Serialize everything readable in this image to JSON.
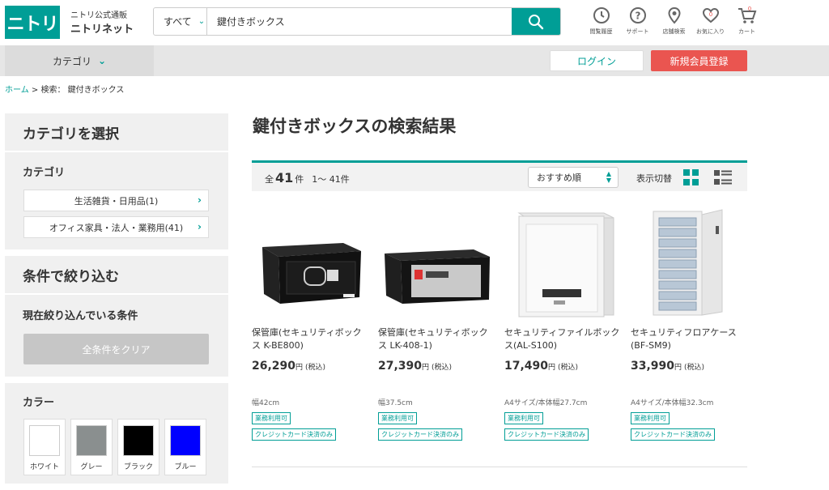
{
  "header": {
    "logo_text": "ニトリ",
    "logo_sub": "ニトリ公式通販",
    "logo_main": "ニトリネット",
    "search_scope": "すべて",
    "search_value": "鍵付きボックス",
    "icons": [
      {
        "name": "history-icon",
        "label": "閲覧履歴"
      },
      {
        "name": "support-icon",
        "label": "サポート"
      },
      {
        "name": "store-search-icon",
        "label": "店舗検索"
      },
      {
        "name": "favorite-icon",
        "label": "お気に入り",
        "badge": "0"
      },
      {
        "name": "cart-icon",
        "label": "カート",
        "badge": "0"
      }
    ]
  },
  "nav": {
    "category": "カテゴリ",
    "login": "ログイン",
    "register": "新規会員登録"
  },
  "breadcrumb": {
    "home": "ホーム",
    "sep": ">",
    "current": "検索： 鍵付きボックス"
  },
  "sidebar": {
    "category_select_title": "カテゴリを選択",
    "category_label": "カテゴリ",
    "categories": [
      {
        "label": "生活雑貨・日用品(1)"
      },
      {
        "label": "オフィス家具・法人・業務用(41)"
      }
    ],
    "filter_title": "条件で絞り込む",
    "current_filter_label": "現在絞り込んでいる条件",
    "clear_all": "全条件をクリア",
    "color_label": "カラー",
    "colors": [
      {
        "label": "ホワイト",
        "hex": "#ffffff"
      },
      {
        "label": "グレー",
        "hex": "#8a8f8f"
      },
      {
        "label": "ブラック",
        "hex": "#000000"
      },
      {
        "label": "ブルー",
        "hex": "#0000ff"
      }
    ]
  },
  "results": {
    "title": "鍵付きボックスの検索結果",
    "total_prefix": "全",
    "total": "41",
    "total_suffix": "件",
    "range": "1～ 41件",
    "sort": "おすすめ順",
    "view_label": "表示切替"
  },
  "products": [
    {
      "name": "保管庫(セキュリティボックス K-BE800)",
      "price": "26,290",
      "yen": "円",
      "tax": "(税込)",
      "size": "幅42cm",
      "tags": [
        "業務利用可",
        "クレジットカード決済のみ"
      ]
    },
    {
      "name": "保管庫(セキュリティボックス LK-408-1)",
      "price": "27,390",
      "yen": "円",
      "tax": "(税込)",
      "size": "幅37.5cm",
      "tags": [
        "業務利用可",
        "クレジットカード決済のみ"
      ]
    },
    {
      "name": "セキュリティファイルボックス(AL-S100)",
      "price": "17,490",
      "yen": "円",
      "tax": "(税込)",
      "size": "A4サイズ/本体幅27.7cm",
      "tags": [
        "業務利用可",
        "クレジットカード決済のみ"
      ]
    },
    {
      "name": "セキュリティフロアケース(BF-SM9)",
      "price": "33,990",
      "yen": "円",
      "tax": "(税込)",
      "size": "A4サイズ/本体幅32.3cm",
      "tags": [
        "業務利用可",
        "クレジットカード決済のみ"
      ]
    }
  ],
  "colors": {
    "accent": "#009e96",
    "register": "#ea5550"
  }
}
